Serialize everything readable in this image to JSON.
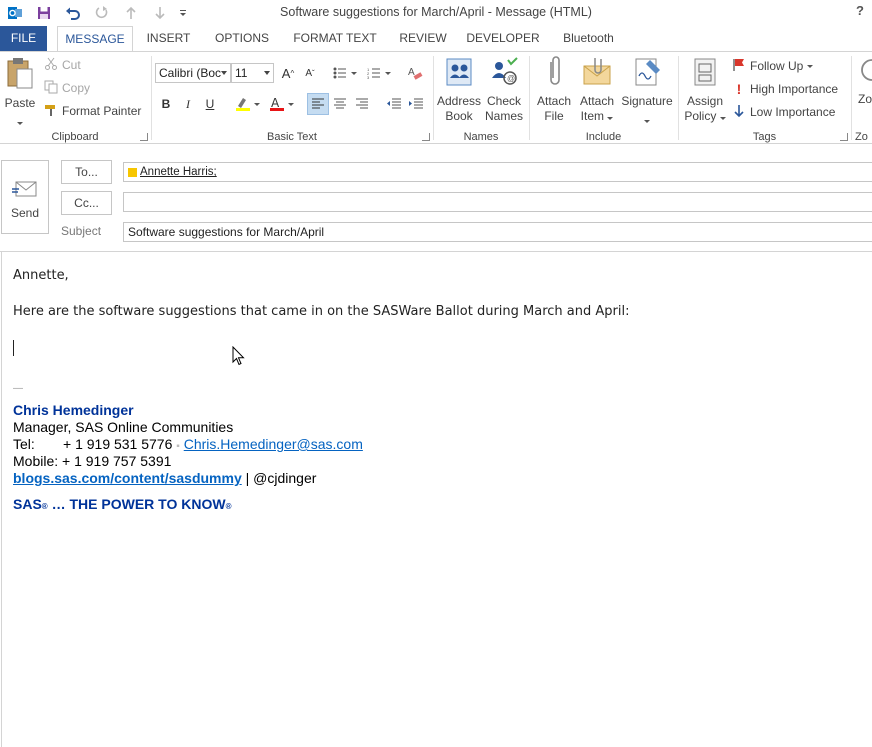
{
  "window": {
    "title": "Software suggestions for March/April - Message (HTML)",
    "help": "?"
  },
  "qat": {
    "icons": [
      "outlook-icon",
      "save-icon",
      "undo-icon",
      "redo-icon",
      "up-arrow-icon",
      "down-arrow-icon",
      "customize-qat-icon"
    ]
  },
  "tabs": [
    {
      "label": "FILE"
    },
    {
      "label": "MESSAGE"
    },
    {
      "label": "INSERT"
    },
    {
      "label": "OPTIONS"
    },
    {
      "label": "FORMAT TEXT"
    },
    {
      "label": "REVIEW"
    },
    {
      "label": "DEVELOPER"
    },
    {
      "label": "Bluetooth"
    }
  ],
  "ribbon": {
    "clipboard": {
      "label": "Clipboard",
      "paste": "Paste",
      "cut": "Cut",
      "copy": "Copy",
      "format_painter": "Format Painter"
    },
    "basic_text": {
      "label": "Basic Text",
      "font_name": "Calibri (Boc",
      "font_size": "11"
    },
    "names": {
      "label": "Names",
      "address_book_1": "Address",
      "address_book_2": "Book",
      "check_names_1": "Check",
      "check_names_2": "Names"
    },
    "include": {
      "label": "Include",
      "attach_file_1": "Attach",
      "attach_file_2": "File",
      "attach_item_1": "Attach",
      "attach_item_2": "Item",
      "signature": "Signature"
    },
    "tags": {
      "label": "Tags",
      "assign_policy_1": "Assign",
      "assign_policy_2": "Policy",
      "follow_up": "Follow Up",
      "high_importance": "High Importance",
      "low_importance": "Low Importance"
    },
    "zoom": {
      "label": "Zo",
      "btn": "Zo"
    }
  },
  "header": {
    "send": "Send",
    "to_button": "To...",
    "cc_button": "Cc...",
    "subject_label": "Subject",
    "to_recipient": "Annette Harris;",
    "cc_value": "",
    "subject_value": "Software suggestions for March/April"
  },
  "body": {
    "greeting": "Annette,",
    "line1": "Here are the software suggestions that came in on the SASWare Ballot during March and April:",
    "sig_dash": "—",
    "sig_name": "Chris Hemedinger",
    "sig_title": "Manager, SAS Online Communities",
    "sig_tel_label": "Tel:",
    "sig_tel": "+ 1 919 531 5776",
    "sig_sep": "▪",
    "sig_email": "Chris.Hemedinger@sas.com",
    "sig_mobile": "Mobile: + 1 919 757 5391",
    "sig_blog": "blogs.sas.com/content/sasdummy",
    "sig_twitter": " | @cjdinger",
    "tagline_sas": "SAS",
    "tagline_reg": "®",
    "tagline_rest": " … THE POWER TO KNOW",
    "tagline_reg2": "®"
  },
  "colors": {
    "accent": "#2b579a",
    "signature_blue": "#003399",
    "link": "#0563c1"
  }
}
